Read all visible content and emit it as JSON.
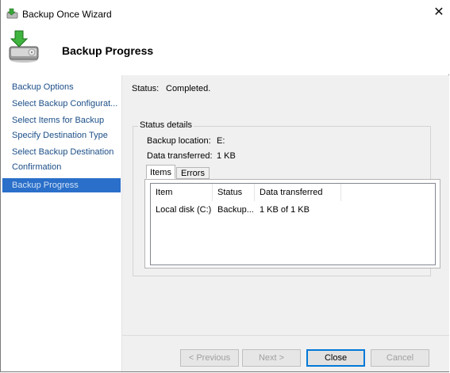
{
  "window": {
    "title": "Backup Once Wizard"
  },
  "header": {
    "title": "Backup Progress"
  },
  "nav": {
    "items": [
      {
        "label": "Backup Options"
      },
      {
        "label": "Select Backup Configurat..."
      },
      {
        "label": "Select Items for Backup"
      },
      {
        "label": "Specify Destination Type"
      },
      {
        "label": "Select Backup Destination"
      },
      {
        "label": "Confirmation"
      },
      {
        "label": "Backup Progress",
        "active": true
      }
    ]
  },
  "status": {
    "label": "Status:",
    "value": "Completed."
  },
  "details": {
    "legend": "Status details",
    "backup_location_label": "Backup location:",
    "backup_location_value": "E:",
    "data_transferred_label": "Data transferred:",
    "data_transferred_value": "1 KB"
  },
  "tabs": {
    "items": "Items",
    "errors": "Errors"
  },
  "table": {
    "columns": [
      "Item",
      "Status",
      "Data transferred"
    ],
    "rows": [
      [
        "Local disk (C:)",
        "Backup...",
        "1 KB of 1 KB"
      ]
    ]
  },
  "buttons": {
    "previous": "< Previous",
    "next": "Next >",
    "close": "Close",
    "cancel": "Cancel"
  },
  "colors": {
    "nav_active_bg": "#2a6fc9",
    "nav_link": "#1c4f88",
    "content_bg": "#f0f0f0",
    "default_button_border": "#0078d7"
  },
  "icons": {
    "title": "backup-icon",
    "header": "backup-drive-icon",
    "close": "close-icon"
  }
}
